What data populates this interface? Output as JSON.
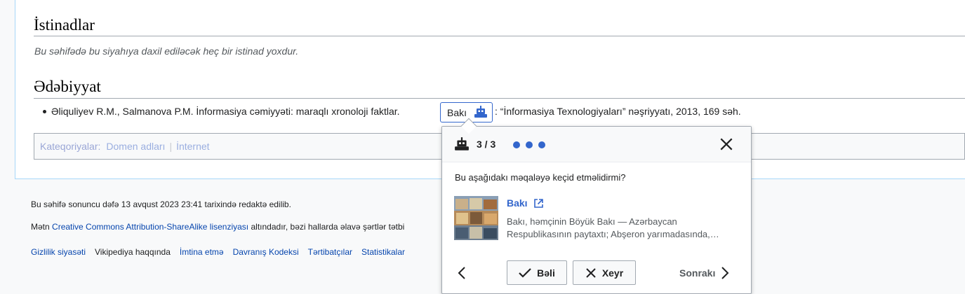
{
  "references": {
    "heading": "İstinadlar",
    "note": "Bu səhifədə bu siyahıya daxil ediləcək heç bir istinad yoxdur."
  },
  "literature": {
    "heading": "Ədəbiyyat",
    "item_before": "Əliquliyev R.M., Salmanova P.M. İnformasiya cəmiyyəti: maraqlı xronoloji faktlar.",
    "chip_label": "Bakı",
    "item_after": ": “İnformasiya Texnologiyaları” nəşriyyatı, 2013, 169 səh."
  },
  "categories": {
    "label": "Kateqoriyalar:",
    "items": [
      "Domen adları",
      "İnternet"
    ]
  },
  "footer": {
    "last_edited": "Bu səhifə sonuncu dəfə 13 avqust 2023 23:41 tarixində redaktə edilib.",
    "license_prefix": "Mətn",
    "license_link": "Creative Commons Attribution-ShareAlike lisenziyası",
    "license_suffix": "altındadır, bəzi hallarda əlavə şərtlər tətbi",
    "links": [
      "Gizlilik siyasəti",
      "Vikipediya haqqında",
      "İmtina etmə",
      "Davranış Kodeksi",
      "Tərtibatçılar",
      "Statistikalar"
    ]
  },
  "popup": {
    "counter": "3 / 3",
    "question": "Bu aşağıdakı məqaləyə keçid etməlidirmi?",
    "article_title": "Bakı",
    "article_desc": "Bakı, həmçinin Böyük Bakı — Azərbaycan Respublikasının paytaxtı; Abşeron yarımadasında,…",
    "yes_label": "Bəli",
    "no_label": "Xeyr",
    "next_label": "Sonrakı",
    "accent_color": "#3366cc"
  }
}
